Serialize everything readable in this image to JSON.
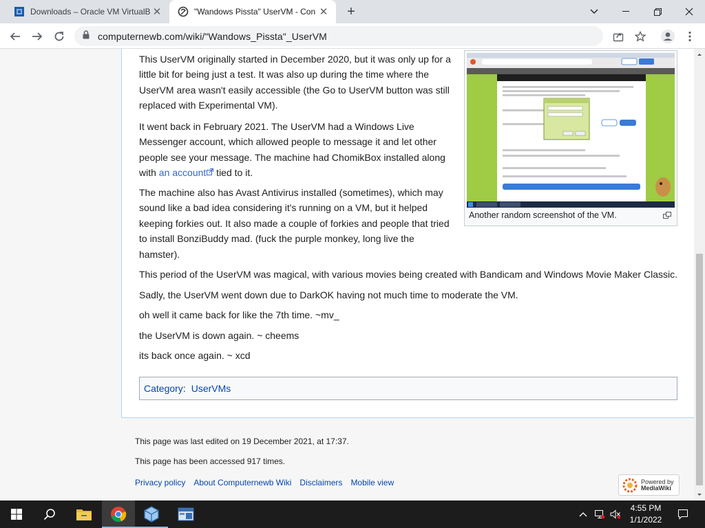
{
  "browser": {
    "tabs": [
      {
        "title": "Downloads – Oracle VM VirtualB",
        "active": false
      },
      {
        "title": "\"Wandows Pissta\" UserVM - Con",
        "active": true
      }
    ],
    "url": "computernewb.com/wiki/\"Wandows_Pissta\"_UserVM"
  },
  "article": {
    "paragraphs": [
      {
        "text": "This UserVM originally started in December 2020, but it was only up for a little bit for being just a test. It was also up during the time where the UserVM area wasn't easily accessible (the Go to UserVM button was still replaced with Experimental VM)."
      },
      {
        "before": "It went back in February 2021. The UserVM had a Windows Live Messenger account, which allowed people to message it and let other people see your message. The machine had ChomikBox installed along with ",
        "link": "an account",
        "after": " tied to it."
      },
      {
        "text": "The machine also has Avast Antivirus installed (sometimes), which may sound like a bad idea considering it's running on a VM, but it helped keeping forkies out. It also made a couple of forkies and people that tried to install BonziBuddy mad. (fuck the purple monkey, long live the hamster)."
      },
      {
        "text": "This period of the UserVM was magical, with various movies being created with Bandicam and Windows Movie Maker Classic."
      },
      {
        "text": "Sadly, the UserVM went down due to DarkOK having not much time to moderate the VM."
      },
      {
        "text": "oh well it came back for like the 7th time. ~mv_"
      },
      {
        "text": "the UserVM is down again. ~ cheems"
      },
      {
        "text": "its back once again. ~ xcd"
      }
    ],
    "thumbnail": {
      "caption": "Another random screenshot of the VM."
    },
    "categories": {
      "label": "Category",
      "separator": ":",
      "items": [
        "UserVMs"
      ]
    }
  },
  "footer": {
    "last_edited": "This page was last edited on 19 December 2021, at 17:37.",
    "accessed": "This page has been accessed 917 times.",
    "links": [
      "Privacy policy",
      "About Computernewb Wiki",
      "Disclaimers",
      "Mobile view"
    ],
    "powered_by": {
      "line1": "Powered by",
      "line2": "MediaWiki"
    }
  },
  "taskbar": {
    "time": "4:55 PM",
    "date": "1/1/2022"
  },
  "colors": {
    "link": "#3366cc",
    "category_link": "#0645ad",
    "content_border": "#a7d7f9",
    "taskbar": "#1c1c1c"
  },
  "icons": [
    "virtualbox-icon",
    "wiki-favicon",
    "close-icon",
    "new-tab-icon",
    "chevron-down-icon",
    "minimize-icon",
    "maximize-icon",
    "back-icon",
    "forward-icon",
    "reload-icon",
    "lock-icon",
    "share-icon",
    "star-icon",
    "profile-icon",
    "menu-icon",
    "windows-start-icon",
    "search-icon",
    "file-explorer-icon",
    "chrome-icon",
    "virtualbox-taskbar-icon",
    "app-icon",
    "chevron-up-icon",
    "network-icon",
    "volume-muted-icon",
    "notification-icon"
  ]
}
